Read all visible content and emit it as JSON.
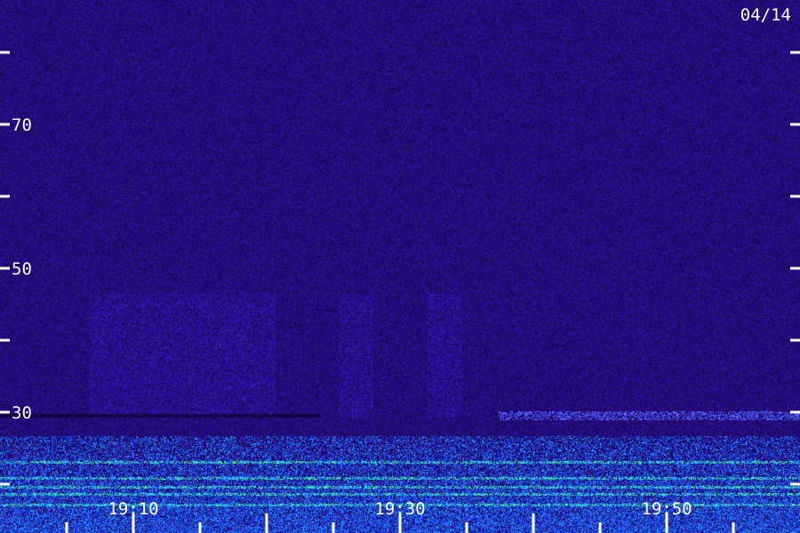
{
  "date_label": "04/14",
  "y_axis": {
    "tick_labels": [
      "70",
      "50",
      "30"
    ]
  },
  "x_axis": {
    "tick_labels": [
      "19:10",
      "19:30",
      "19:50"
    ]
  },
  "colors": {
    "background": "#3a1890",
    "noise_bright": "#6a3ae0",
    "band_cyan": "#20c0ff",
    "band_green": "#40ff80",
    "axis_text": "#ffffff"
  }
}
